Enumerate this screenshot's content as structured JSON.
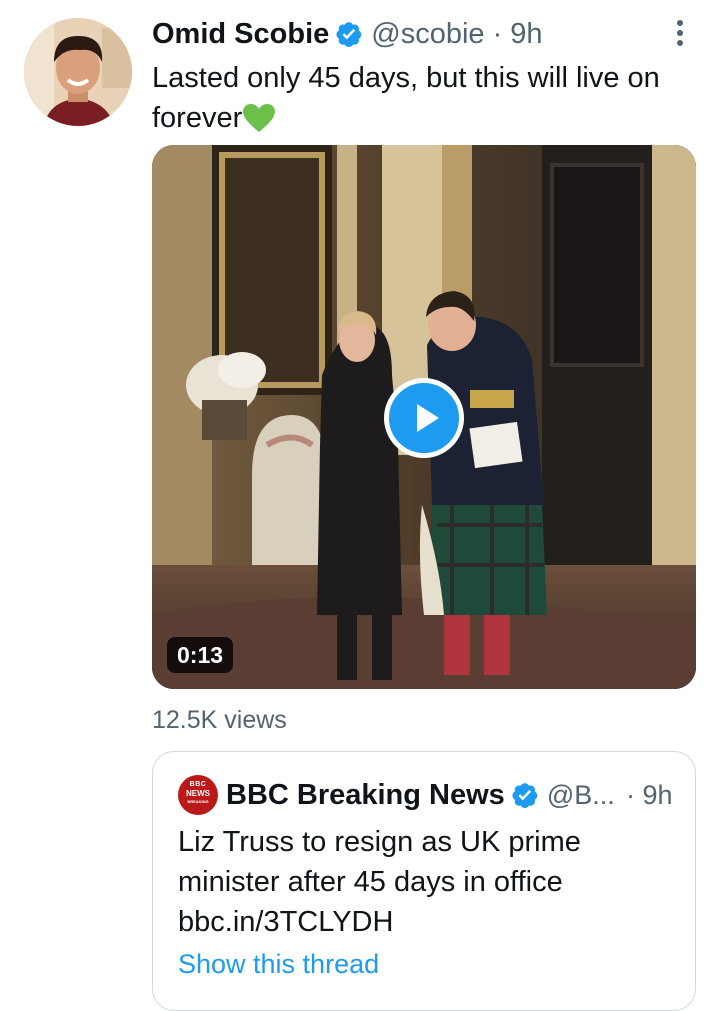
{
  "tweet": {
    "author_name": "Omid Scobie",
    "author_handle": "@scobie · 9h",
    "text": "Lasted only 45 days, but this will live on forever",
    "video_duration": "0:13",
    "views": "12.5K views"
  },
  "quoted_tweet": {
    "logo_text": [
      "BBC",
      "NEWS",
      "BREAKING"
    ],
    "author_name": "BBC Breaking News",
    "author_handle": "@B...",
    "time": "· 9h",
    "text_line1": "Liz Truss to resign as UK prime",
    "text_line2": "minister after 45 days in office",
    "text_line3": "bbc.in/3TCLYDH",
    "show_thread": "Show this thread"
  },
  "icons": {
    "verified": "verified-badge-icon",
    "more": "more-vertical-icon",
    "heart": "green-heart-emoji",
    "play": "play-icon"
  },
  "colors": {
    "accent": "#1d9bf0",
    "text": "#0f1419",
    "secondary": "#536471",
    "heart": "#6bbf4a",
    "bbc_red": "#bb1919"
  }
}
